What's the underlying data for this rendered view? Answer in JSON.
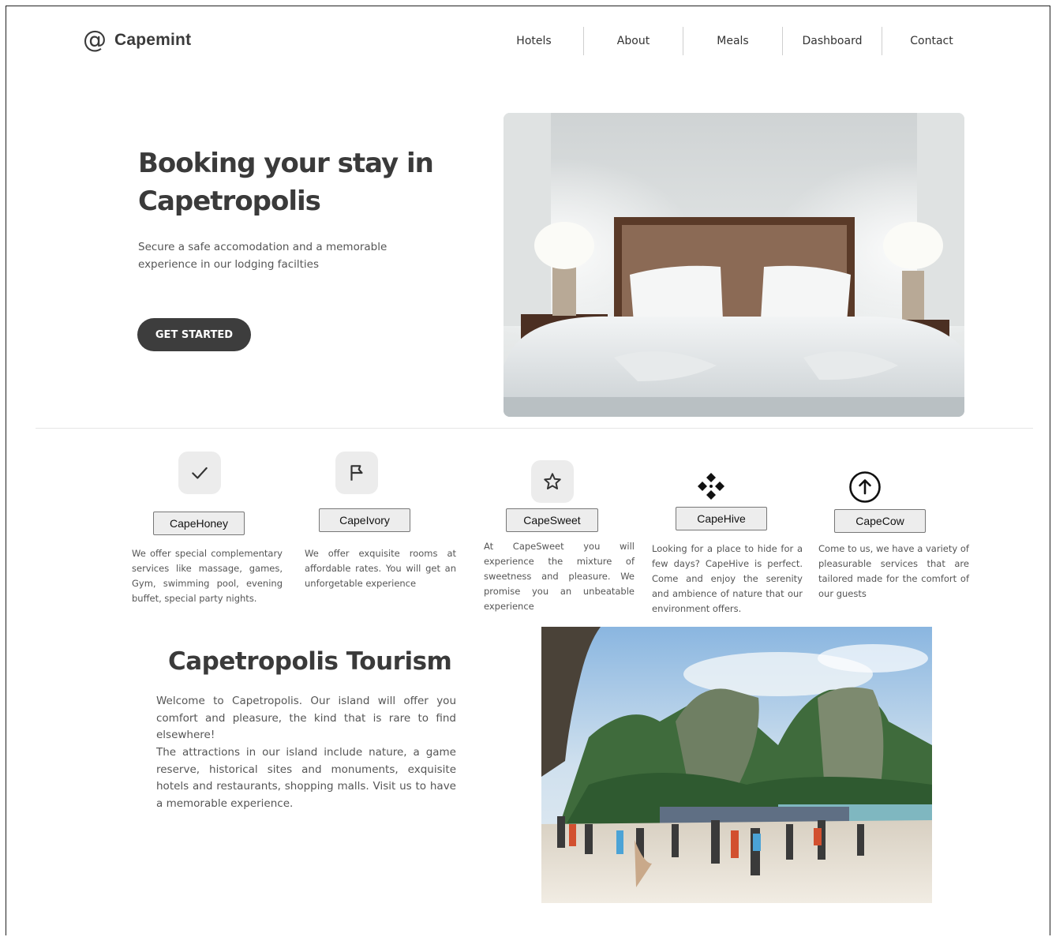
{
  "brand": {
    "icon": "at-sign-icon",
    "name": "Capemint"
  },
  "nav": [
    {
      "label": "Hotels"
    },
    {
      "label": "About"
    },
    {
      "label": "Meals"
    },
    {
      "label": "Dashboard"
    },
    {
      "label": "Contact"
    }
  ],
  "hero": {
    "title": "Booking your stay in Capetropolis",
    "subtitle": "Secure a safe accomodation and a memorable experience in our lodging facilties",
    "cta_label": "GET STARTED"
  },
  "features": [
    {
      "name": "CapeHoney",
      "icon": "check-icon",
      "description": "We offer special complementary services like massage, games, Gym, swimming pool, evening buffet, special party nights."
    },
    {
      "name": "CapeIvory",
      "icon": "flag-icon",
      "description": "We offer exquisite rooms at affordable rates. You will get an unforgetable experience"
    },
    {
      "name": "CapeSweet",
      "icon": "star-icon",
      "description": "At CapeSweet you will experience the mixture of sweetness and pleasure. We promise you an unbeatable experience"
    },
    {
      "name": "CapeHive",
      "icon": "diamond-cluster-icon",
      "description": "Looking for a place to hide for a few days? CapeHive is perfect. Come and enjoy the serenity and ambience of nature that our environment offers."
    },
    {
      "name": "CapeCow",
      "icon": "arrow-up-circle-icon",
      "description": "Come to us, we have a variety of pleasurable services that are tailored made for the comfort of our guests"
    }
  ],
  "tourism": {
    "title": "Capetropolis Tourism",
    "paragraph1": "Welcome to Capetropolis. Our island will offer you comfort and pleasure, the kind that is rare to find elsewhere!",
    "paragraph2": "The attractions in our island include nature, a game reserve, historical sites and monuments, exquisite hotels and restaurants, shopping malls.  Visit us to have a memorable experience."
  },
  "colors": {
    "primary_dark": "#3d3d3d",
    "text": "#555555",
    "icon_bg": "#ececec"
  }
}
